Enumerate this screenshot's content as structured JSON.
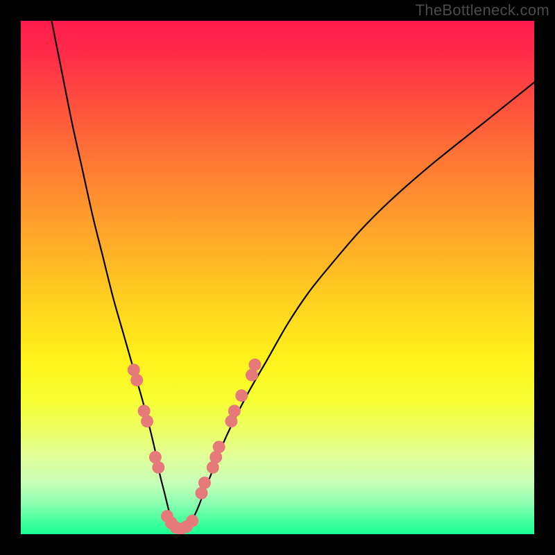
{
  "watermark": "TheBottleneck.com",
  "gradient": {
    "stops": [
      {
        "offset": 0.0,
        "color": "#ff1a4d"
      },
      {
        "offset": 0.06,
        "color": "#ff2a49"
      },
      {
        "offset": 0.15,
        "color": "#ff4b3f"
      },
      {
        "offset": 0.28,
        "color": "#ff7a33"
      },
      {
        "offset": 0.42,
        "color": "#ffa82a"
      },
      {
        "offset": 0.55,
        "color": "#ffd21f"
      },
      {
        "offset": 0.66,
        "color": "#fff21a"
      },
      {
        "offset": 0.74,
        "color": "#f7ff33"
      },
      {
        "offset": 0.8,
        "color": "#ecff66"
      },
      {
        "offset": 0.85,
        "color": "#e0ff99"
      },
      {
        "offset": 0.9,
        "color": "#c8ffb8"
      },
      {
        "offset": 0.94,
        "color": "#8cffb0"
      },
      {
        "offset": 0.97,
        "color": "#4dffa0"
      },
      {
        "offset": 1.0,
        "color": "#19ff94"
      }
    ]
  },
  "plot": {
    "inner_x": 30,
    "inner_y": 30,
    "inner_w": 740,
    "inner_h": 740,
    "x_domain": [
      0,
      100
    ],
    "y_domain": [
      0,
      100
    ]
  },
  "chart_data": {
    "type": "line",
    "title": "",
    "xlabel": "",
    "ylabel": "",
    "xlim": [
      0,
      100
    ],
    "ylim": [
      0,
      100
    ],
    "series": [
      {
        "name": "bottleneck-curve",
        "x": [
          6,
          8,
          10,
          12,
          14,
          16,
          18,
          20,
          22,
          24,
          26,
          27,
          28,
          29,
          30,
          32,
          34,
          36,
          38,
          40,
          44,
          48,
          52,
          56,
          60,
          66,
          72,
          80,
          90,
          100
        ],
        "y": [
          100,
          90,
          80,
          71,
          62,
          54,
          46,
          39,
          32,
          25,
          17,
          12,
          8,
          4,
          1,
          1,
          4,
          9,
          14,
          19,
          27,
          34,
          41,
          47,
          52,
          59,
          65,
          72,
          80,
          88
        ]
      }
    ],
    "markers": {
      "name": "highlight-dots",
      "color": "#e67a7a",
      "radius_px": 9,
      "points": [
        {
          "x": 22.0,
          "y": 32
        },
        {
          "x": 22.6,
          "y": 30
        },
        {
          "x": 24.0,
          "y": 24
        },
        {
          "x": 24.6,
          "y": 22
        },
        {
          "x": 26.2,
          "y": 15
        },
        {
          "x": 26.8,
          "y": 13
        },
        {
          "x": 28.5,
          "y": 3.5
        },
        {
          "x": 29.3,
          "y": 2.2
        },
        {
          "x": 30.2,
          "y": 1.3
        },
        {
          "x": 31.2,
          "y": 1.0
        },
        {
          "x": 32.3,
          "y": 1.5
        },
        {
          "x": 33.4,
          "y": 2.6
        },
        {
          "x": 35.2,
          "y": 8
        },
        {
          "x": 35.8,
          "y": 10
        },
        {
          "x": 37.4,
          "y": 13
        },
        {
          "x": 38.0,
          "y": 15
        },
        {
          "x": 38.6,
          "y": 17
        },
        {
          "x": 41.0,
          "y": 22
        },
        {
          "x": 41.6,
          "y": 24
        },
        {
          "x": 43.0,
          "y": 27
        },
        {
          "x": 45.0,
          "y": 31
        },
        {
          "x": 45.6,
          "y": 33
        }
      ]
    }
  }
}
